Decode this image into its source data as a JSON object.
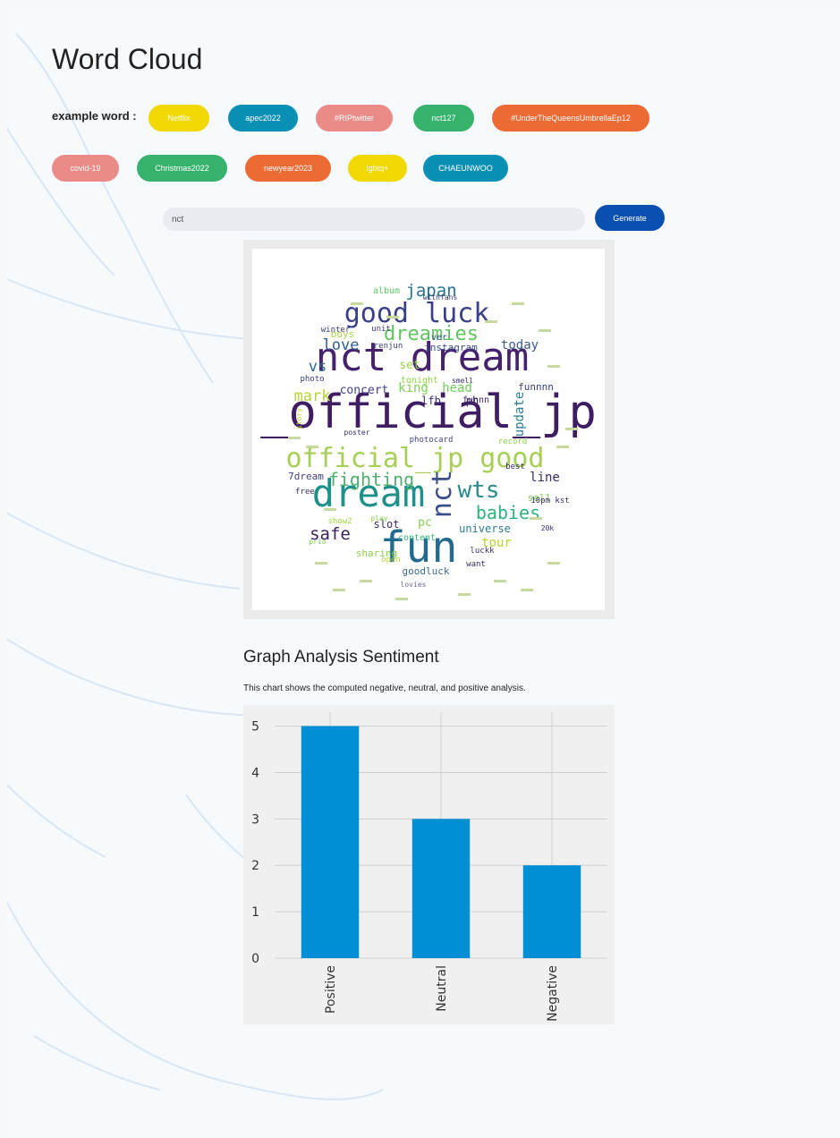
{
  "page": {
    "title": "Word Cloud",
    "example_label": "example word :"
  },
  "example_words": [
    {
      "label": "Netflix",
      "color": "#f0d800"
    },
    {
      "label": "apec2022",
      "color": "#0a8fb5"
    },
    {
      "label": "#RIPtwitter",
      "color": "#ea8b88"
    },
    {
      "label": "nct127",
      "color": "#36b26c"
    },
    {
      "label": "#UnderTheQueensUmbrellaEp12",
      "color": "#ec6b35"
    },
    {
      "label": "covid-19",
      "color": "#ea8b88"
    },
    {
      "label": "Christmas2022",
      "color": "#36b26c"
    },
    {
      "label": "newyear2023",
      "color": "#ec6b35"
    },
    {
      "label": "lgbtq+",
      "color": "#f0d800"
    },
    {
      "label": "CHAEUNWOO",
      "color": "#0a8fb5"
    }
  ],
  "search": {
    "value": "nct",
    "placeholder": ""
  },
  "generate_label": "Generate",
  "word_cloud": {
    "words": [
      {
        "text": "_official_jp",
        "color": "#3f1d62"
      },
      {
        "text": "nct dream",
        "color": "#46226e"
      },
      {
        "text": "official_jp good",
        "color": "#a7cf55"
      },
      {
        "text": "dream",
        "color": "#1f8f8a"
      },
      {
        "text": "fun",
        "color": "#236b8e"
      },
      {
        "text": "good luck",
        "color": "#3a3f8c"
      },
      {
        "text": "dreamies",
        "color": "#62c361"
      },
      {
        "text": "nct",
        "color": "#3b4e8c"
      },
      {
        "text": "wts",
        "color": "#2a8a8c"
      },
      {
        "text": "babies",
        "color": "#2db27d"
      },
      {
        "text": "fighting",
        "color": "#4fb06b"
      },
      {
        "text": "japan",
        "color": "#27728e"
      },
      {
        "text": "safe",
        "color": "#3b1f5e"
      },
      {
        "text": "mark",
        "color": "#b6d538"
      },
      {
        "text": "love",
        "color": "#2c5d8b"
      },
      {
        "text": "vs",
        "color": "#31688e"
      },
      {
        "text": "today",
        "color": "#3a5a8c"
      },
      {
        "text": "update",
        "color": "#2b7f8e"
      },
      {
        "text": "concert",
        "color": "#414487"
      },
      {
        "text": "king",
        "color": "#7ad151"
      },
      {
        "text": "head",
        "color": "#6ccd5a"
      },
      {
        "text": "line",
        "color": "#3a2a6a"
      },
      {
        "text": "tour",
        "color": "#b4d62a"
      },
      {
        "text": "instagram",
        "color": "#3d4c8a"
      },
      {
        "text": "universe",
        "color": "#2a7c8e"
      },
      {
        "text": "goodluck",
        "color": "#3a6a8c"
      },
      {
        "text": "sharing",
        "color": "#8bd046"
      },
      {
        "text": "content",
        "color": "#35b779"
      },
      {
        "text": "slot",
        "color": "#3a2a6a"
      },
      {
        "text": "pc",
        "color": "#87ce4e"
      },
      {
        "text": "set",
        "color": "#9ad44a"
      },
      {
        "text": "funnnn",
        "color": "#3b3d7c"
      },
      {
        "text": "funnn",
        "color": "#4a2a70"
      },
      {
        "text": "lfb",
        "color": "#3a2a6a"
      },
      {
        "text": "ph",
        "color": "#3a2a6a"
      },
      {
        "text": "boys",
        "color": "#a8d44a"
      },
      {
        "text": "album",
        "color": "#5dc863"
      },
      {
        "text": "sell",
        "color": "#7ad151"
      },
      {
        "text": "7dream",
        "color": "#414487"
      },
      {
        "text": "show2",
        "color": "#9dd93b"
      },
      {
        "text": "tonight",
        "color": "#90d743"
      },
      {
        "text": "photocard",
        "color": "#404688"
      },
      {
        "text": "ver",
        "color": "#3b4d8a"
      },
      {
        "text": "want",
        "color": "#3a2a6a"
      },
      {
        "text": "10pm kst",
        "color": "#3a2a6a"
      },
      {
        "text": "open",
        "color": "#b6d538"
      },
      {
        "text": "lovies",
        "color": "#6a6a9a"
      },
      {
        "text": "photo",
        "color": "#3a3a7a"
      },
      {
        "text": "winter",
        "color": "#3a3a7a"
      },
      {
        "text": "free",
        "color": "#3a2a6a"
      },
      {
        "text": "best",
        "color": "#3a2a6a"
      },
      {
        "text": "record",
        "color": "#8bd046"
      },
      {
        "text": "poster",
        "color": "#3a2a6a"
      },
      {
        "text": "play",
        "color": "#8bd046"
      },
      {
        "text": "unit",
        "color": "#3a3a7a"
      },
      {
        "text": "withfans",
        "color": "#3a3a7a"
      },
      {
        "text": "renjun",
        "color": "#3a3a7a"
      },
      {
        "text": "story",
        "color": "#b4d62a"
      },
      {
        "text": "20k",
        "color": "#3a2a6a"
      },
      {
        "text": "luckk",
        "color": "#3a2a6a"
      },
      {
        "text": "prio",
        "color": "#7ad151"
      },
      {
        "text": "smell",
        "color": "#3a2a6a"
      }
    ]
  },
  "sentiment": {
    "title": "Graph Analysis Sentiment",
    "description": "This chart shows the computed negative, neutral, and positive analysis."
  },
  "chart_data": {
    "type": "bar",
    "categories": [
      "Positive",
      "Neutral",
      "Negative"
    ],
    "values": [
      5,
      3,
      2
    ],
    "yticks": [
      "0",
      "1",
      "2",
      "3",
      "4",
      "5"
    ],
    "ylim": [
      0,
      5.3
    ],
    "grid": true,
    "bar_color": "#008fd5",
    "xlabel": "",
    "ylabel": "",
    "title": ""
  }
}
